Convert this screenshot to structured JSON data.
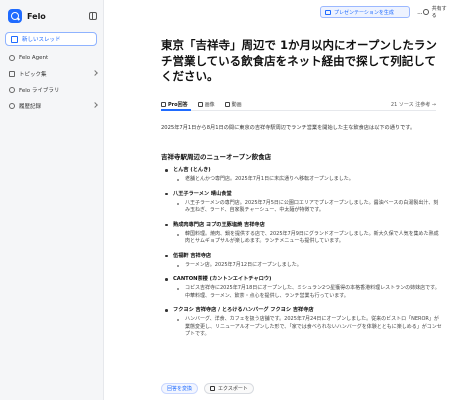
{
  "app": {
    "name": "Felo"
  },
  "sidebar": {
    "new_thread": "新しいスレッド",
    "items": [
      {
        "label": "Felo Agent",
        "icon": "agent-icon"
      },
      {
        "label": "トピック集",
        "icon": "topic-icon"
      },
      {
        "label": "Felo ライブラリ",
        "icon": "library-icon"
      },
      {
        "label": "履歴記録",
        "icon": "history-icon"
      }
    ]
  },
  "topbar": {
    "present_label": "プレゼンテーションを生成",
    "share_label": "共有する"
  },
  "main": {
    "question": "東京「吉祥寺」周辺で 1か月以内にオープンしたランチ営業している飲食店をネット経由で探して列記してください。",
    "tabs": [
      {
        "label": "Pro回答",
        "active": true
      },
      {
        "label": "画像"
      },
      {
        "label": "動画"
      }
    ],
    "sources": "21 ソース 注参考 →",
    "intro": "2025年7月1日から8月1日の間に東京の吉祥寺駅周辺でランチ営業を開始した主な飲食店は以下の通りです。",
    "section_title": "吉祥寺駅周辺のニューオープン飲食店",
    "entries": [
      {
        "name": "とん吉 (とんき)",
        "desc": "老舗とんかつ専門店。2025年7月1日に末広通りへ移転オープンしました。"
      },
      {
        "name": "八王子ラーメン 晴山食堂",
        "desc": "八王子ラーメンの専門店。2025年7月5日に公園口エリアでプレオープンしました。醤油ベースの白湯製出汁、刻み玉ねぎ、ラード、自家製チャーシュー、中太麺が特徴です。"
      },
      {
        "name": "熟成肉専門店 ヨプの王豚塩焼 吉祥寺店",
        "desc": "韓国料理。焼肉、鍋を提供する店で、2025年7月9日にグランドオープンしました。新大久保で人気を集めた熟成肉とサムギョプサルが楽しめます。ランチメニューも提供しています。"
      },
      {
        "name": "伍福軒 吉祥寺店",
        "desc": "ラーメン店。2025年7月12日にオープンしました。"
      },
      {
        "name": "CANTON茶楼 (カントンエイトチャロウ)",
        "desc": "コピス吉祥寺に2025年7月18日にオープンした、ミシュラン2つ星獲得の本格香港料理レストランの姉妹店です。中華料理、ラーメン、飲茶・点心を提供し、ランチ営業も行っています。"
      },
      {
        "name": "フクヨシ 吉祥寺店 / とろけるハンバーグ フクヨシ 吉祥寺店",
        "desc": "ハンバーグ、洋食、カフェを扱う店舗です。2025年7月24日にオープンしました。従来のビストロ「NEROR」が業態変更し、リニューアルオープンした形で、「家では食べられないハンバーグを体験とともに楽しめる」がコンセプトです。"
      }
    ]
  },
  "bottom": {
    "format_label": "回答を変換",
    "export_label": "エクスポート"
  },
  "colors": {
    "accent": "#1f6bff",
    "sidebar_bg": "#f5f6f8"
  }
}
